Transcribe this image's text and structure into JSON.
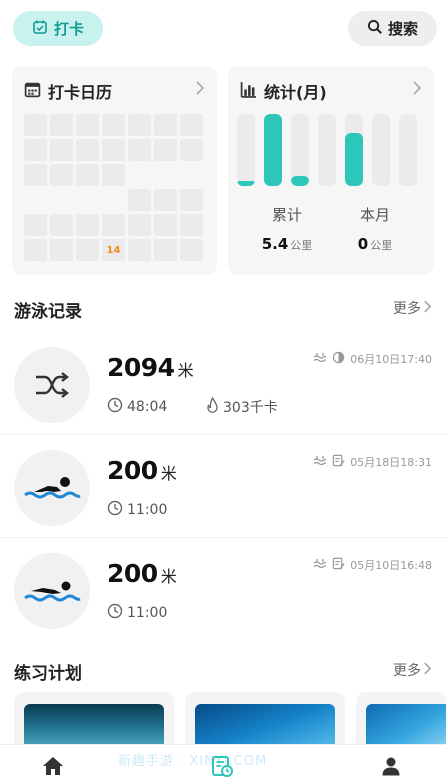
{
  "header": {
    "checkin_label": "打卡",
    "search_label": "搜索"
  },
  "calendar_card": {
    "title": "打卡日历",
    "highlighted_day": "14",
    "cells": [
      "",
      "",
      "",
      "",
      "",
      "",
      "",
      "",
      "",
      "",
      "",
      "",
      "",
      "",
      "",
      "",
      "",
      "",
      "blank",
      "blank",
      "blank",
      "blank",
      "blank",
      "blank",
      "blank",
      "",
      "",
      "",
      "",
      "",
      "",
      "",
      "",
      "",
      "",
      "",
      "",
      "",
      "14",
      "",
      "",
      ""
    ]
  },
  "stats_card": {
    "title": "统计(月)",
    "bar_levels": [
      0.06,
      1.0,
      0.14,
      0.0,
      0.74,
      0.0,
      0.0
    ],
    "accent_color": "#2cc6bb",
    "total_label": "累计",
    "total_value": "5.4",
    "total_unit": "公里",
    "month_label": "本月",
    "month_value": "0",
    "month_unit": "公里"
  },
  "swim_section": {
    "title": "游泳记录",
    "more_label": "更多",
    "records": [
      {
        "icon": "shuffle-icon",
        "distance": "2094",
        "unit": "米",
        "duration": "48:04",
        "calories": "303千卡",
        "datetime": "06月10日17:40"
      },
      {
        "icon": "swimmer-icon",
        "distance": "200",
        "unit": "米",
        "duration": "11:00",
        "calories": "",
        "datetime": "05月18日18:31"
      },
      {
        "icon": "swimmer-icon",
        "distance": "200",
        "unit": "米",
        "duration": "11:00",
        "calories": "",
        "datetime": "05月10日16:48"
      }
    ]
  },
  "plan_section": {
    "title": "练习计划",
    "more_label": "更多"
  },
  "tabbar": {
    "items": [
      "home-icon",
      "swim-log-icon",
      "profile-icon"
    ]
  },
  "watermark": "新趣手游 · XINYI.COM"
}
